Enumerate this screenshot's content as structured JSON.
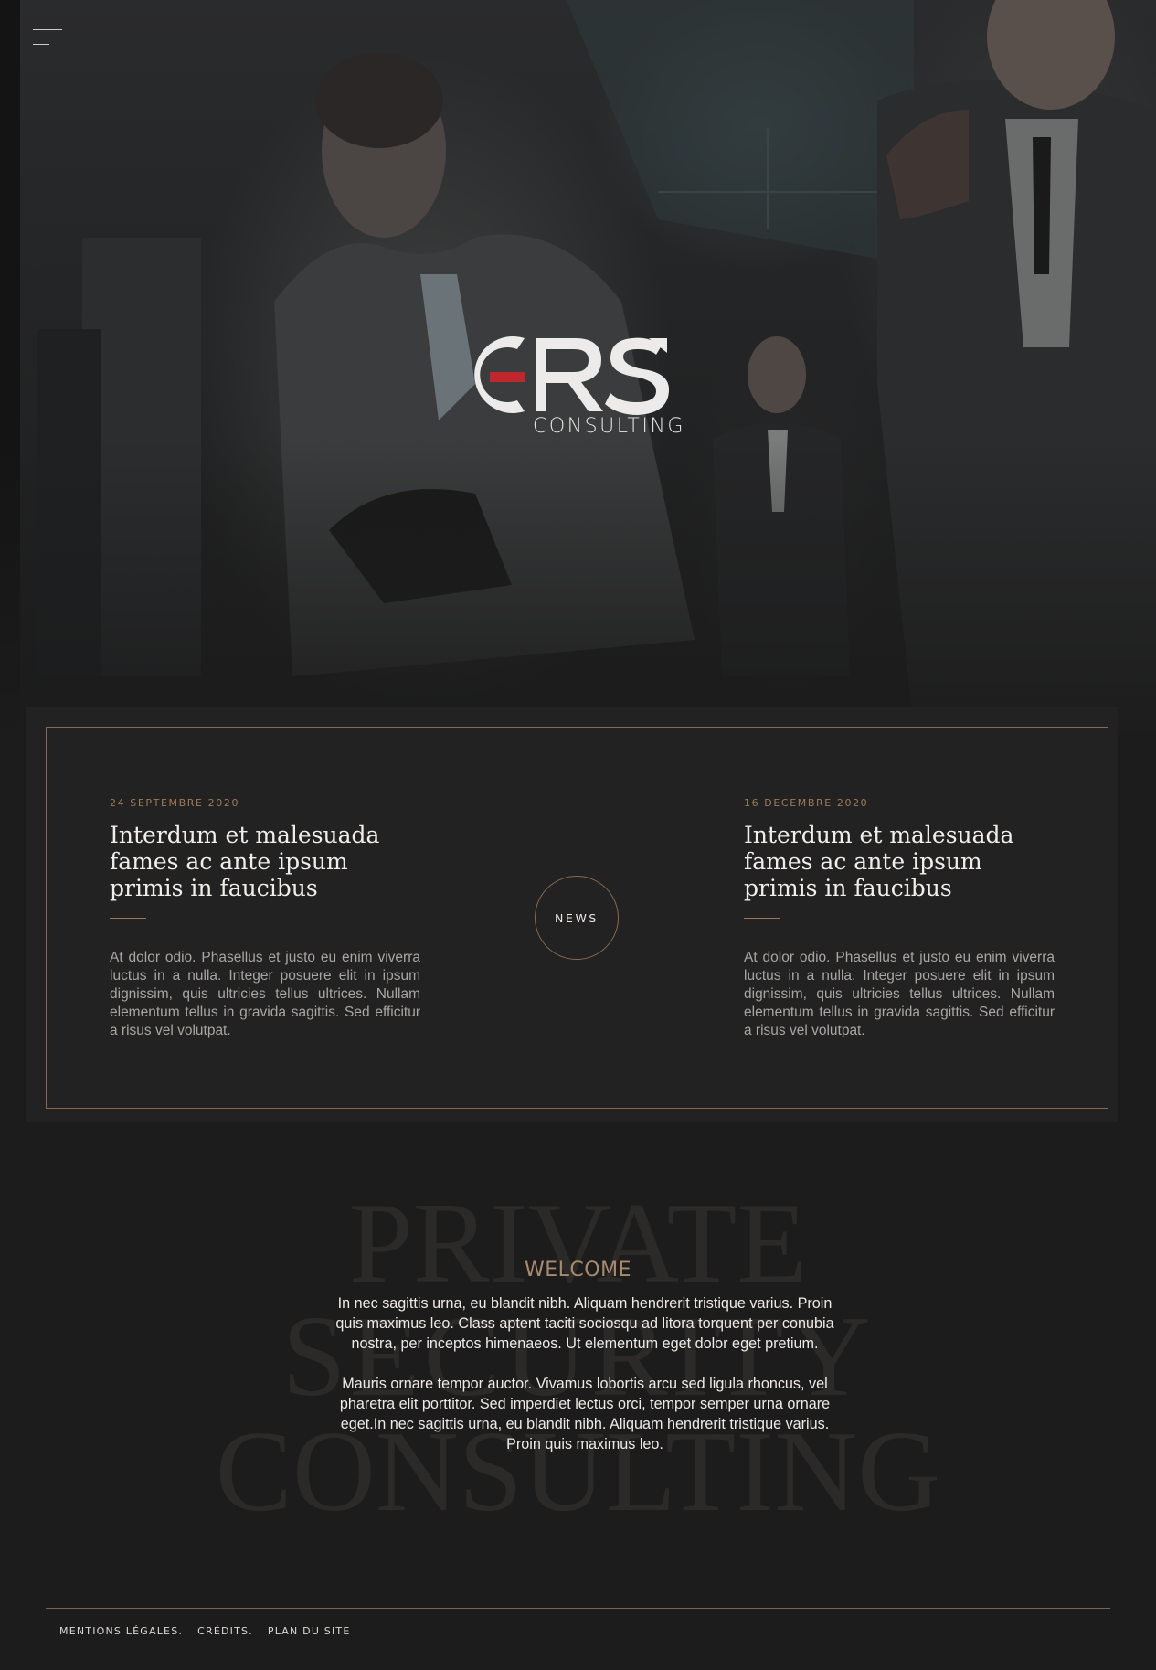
{
  "header": {
    "menu_icon": "hamburger-menu-icon"
  },
  "hero": {
    "logo_text": "CRS",
    "logo_subtitle": "CONSULTING",
    "accent_color": "#c0272d"
  },
  "news": {
    "badge_label": "NEWS",
    "articles": [
      {
        "date": "24 SEPTEMBRE 2020",
        "title": "Interdum et malesuada fames ac ante ipsum primis in faucibus",
        "body": "At dolor odio. Phasellus et justo eu enim viverra luctus in a nulla. Integer posuere elit in ipsum dignissim, quis ultricies tellus ultrices. Nullam elementum tellus in gravida sagittis. Sed efficitur a risus vel volutpat."
      },
      {
        "date": "16 DECEMBRE 2020",
        "title": "Interdum et malesuada fames ac ante ipsum primis in faucibus",
        "body": "At dolor odio. Phasellus et justo eu enim viverra luctus in a nulla. Integer posuere elit in ipsum dignissim, quis ultricies tellus ultrices. Nullam elementum tellus in gravida sagittis. Sed efficitur a risus vel volutpat."
      }
    ]
  },
  "welcome": {
    "background_words": [
      "PRIVATE",
      "SECURITY",
      "CONSULTING"
    ],
    "title": "WELCOME",
    "paragraphs": [
      "In nec sagittis urna, eu blandit nibh. Aliquam hendrerit tristique varius. Proin quis maximus leo. Class aptent taciti sociosqu ad litora torquent per conubia nostra, per inceptos himenaeos. Ut elementum eget dolor eget pretium.",
      "Mauris ornare tempor auctor. Vivamus lobortis arcu sed ligula rhoncus, vel pharetra elit porttitor. Sed imperdiet lectus orci, tempor semper urna ornare eget.In nec sagittis urna, eu blandit nibh. Aliquam hendrerit tristique varius. Proin quis maximus leo."
    ]
  },
  "footer": {
    "links": [
      "MENTIONS LÉGALES.",
      "CRÉDITS.",
      "PLAN DU SITE"
    ]
  },
  "colors": {
    "background": "#1c1c1c",
    "gold": "#8a6a4e",
    "date": "#a07a58",
    "welcome_title": "#a88a6e"
  }
}
